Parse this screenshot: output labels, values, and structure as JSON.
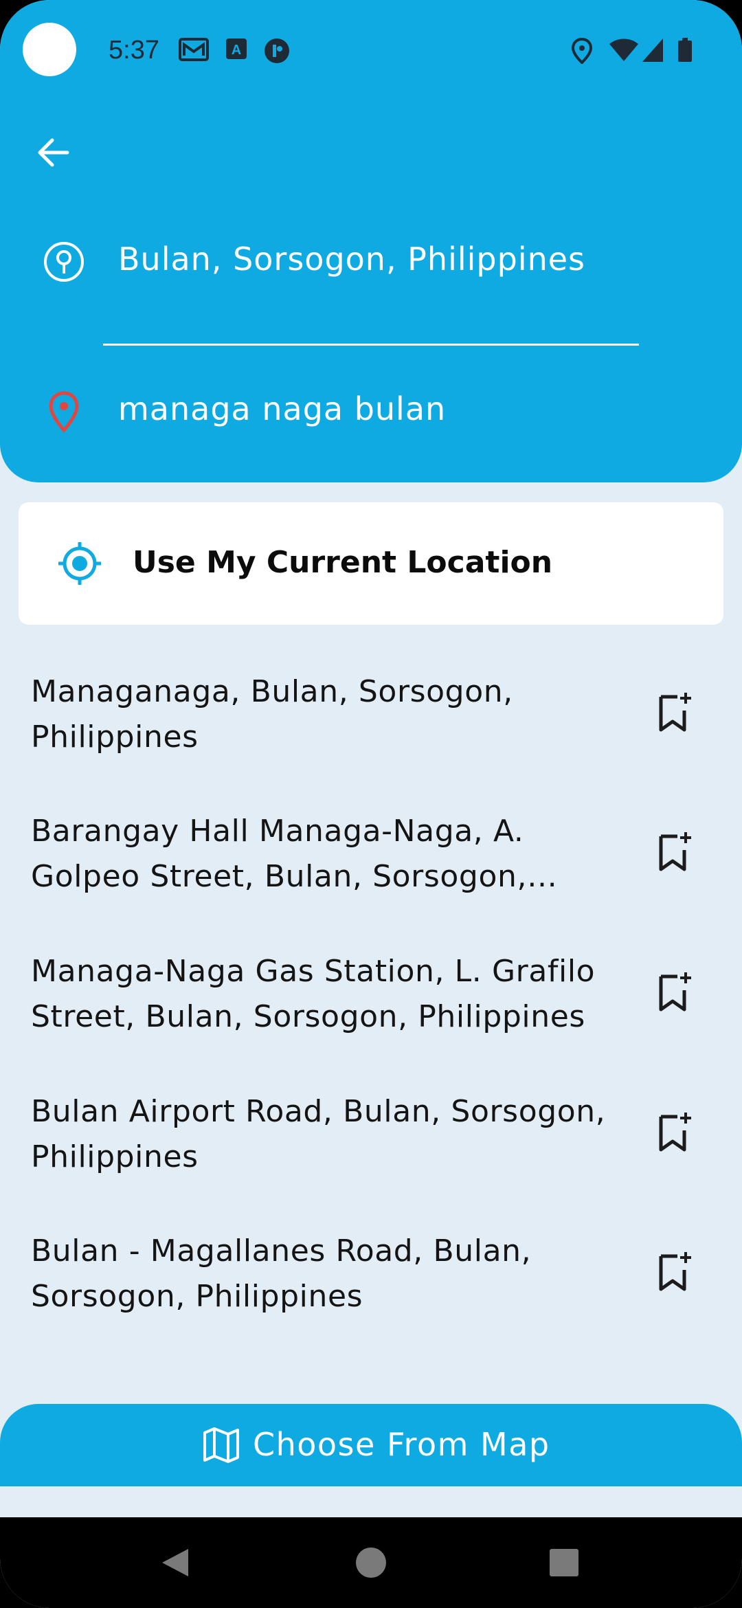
{
  "status_bar": {
    "time": "5:37",
    "left_icons": [
      "gmail-icon",
      "text-icon",
      "app-icon"
    ],
    "right_icons": [
      "location-icon",
      "wifi-icon",
      "signal-icon",
      "battery-icon"
    ]
  },
  "header": {
    "origin": {
      "value": "Bulan, Sorsogon, Philippines",
      "icon": "origin-pin-icon"
    },
    "destination": {
      "value": "managa naga bulan",
      "icon": "destination-pin-icon"
    }
  },
  "current_location": {
    "label": "Use My Current Location",
    "icon": "gps-target-icon"
  },
  "results": [
    {
      "text": "Managanaga, Bulan, Sorsogon, Philippines"
    },
    {
      "text": "Barangay Hall Managa-Naga, A. Golpeo Street, Bulan, Sorsogon, Philippines"
    },
    {
      "text": "Managa-Naga Gas Station, L. Grafilo Street, Bulan, Sorsogon, Philippines"
    },
    {
      "text": "Bulan Airport Road, Bulan, Sorsogon, Philippines"
    },
    {
      "text": "Bulan - Magallanes Road, Bulan, Sorsogon, Philippines"
    }
  ],
  "bottom": {
    "choose_map_label": "Choose From Map",
    "icon": "map-icon"
  },
  "colors": {
    "accent": "#0faae2",
    "background": "#e3edf5",
    "destination_pin": "#e2463f"
  }
}
